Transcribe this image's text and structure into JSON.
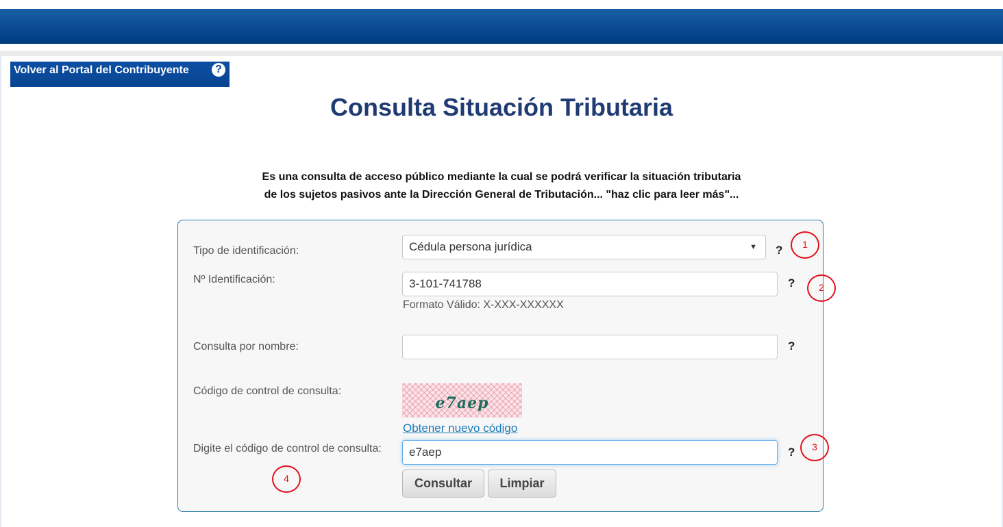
{
  "portal_link": {
    "label": "Volver al Portal del Contribuyente",
    "help_icon": "question-circle-icon"
  },
  "page_title": "Consulta Situación Tributaria",
  "intro": {
    "line1": "Es una consulta de acceso público mediante la cual se podrá verificar la situación tributaria",
    "line2": "de los sujetos pasivos ante la Dirección General de Tributación... \"haz clic para leer más\"..."
  },
  "form": {
    "id_type": {
      "label": "Tipo de identificación:",
      "selected": "Cédula persona jurídica",
      "help": "?"
    },
    "id_number": {
      "label": "Nº Identificación:",
      "value": "3-101-741788",
      "format_hint": "Formato Válido: X-XXX-XXXXXX",
      "help": "?"
    },
    "by_name": {
      "label": "Consulta por nombre:",
      "value": "",
      "help": "?"
    },
    "captcha": {
      "label": "Código de control de consulta:",
      "image_text": "e7aep",
      "new_code_link": "Obtener nuevo código"
    },
    "captcha_input": {
      "label": "Digite el código de control de consulta:",
      "value": "e7aep",
      "help": "?"
    },
    "buttons": {
      "submit": "Consultar",
      "clear": "Limpiar"
    }
  },
  "annotations": [
    "1",
    "2",
    "3",
    "4"
  ],
  "colors": {
    "banner": "#0a4b93",
    "title": "#1f3b73",
    "panel_border": "#2b7aa8",
    "link": "#1a7ab8",
    "annotation": "#e0101a"
  }
}
